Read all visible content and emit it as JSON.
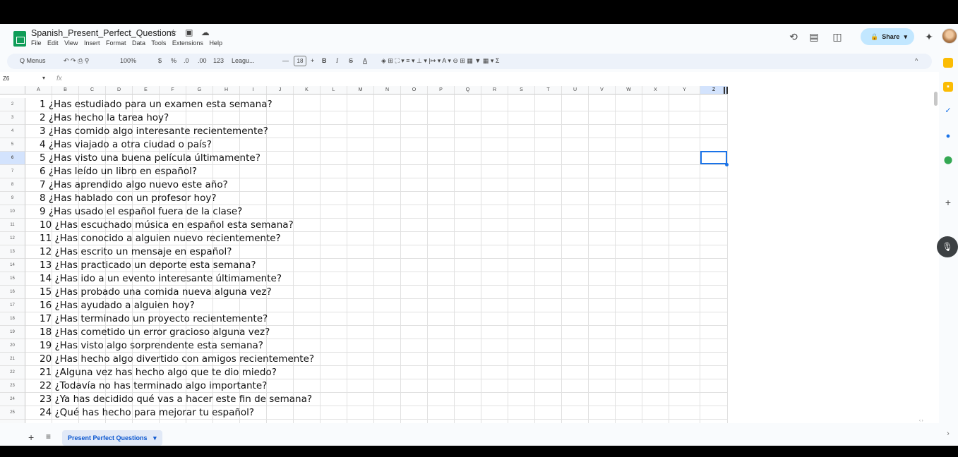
{
  "doc": {
    "title": "Spanish_Present_Perfect_Questions",
    "title_icons": "☆ ▣ ☁"
  },
  "menu": [
    "File",
    "Edit",
    "View",
    "Insert",
    "Format",
    "Data",
    "Tools",
    "Extensions",
    "Help"
  ],
  "header_right": {
    "share_label": "Share"
  },
  "toolbar": {
    "menus_label": "Q Menus",
    "undo_redo": "↶ ↷ ⎙ ⚲",
    "zoom": "100%",
    "currency": "$",
    "percent": "%",
    "dec_minus": ".0",
    "dec_plus": ".00",
    "num_format": "123",
    "font": "Leagu...",
    "minus": "—",
    "font_size": "18",
    "plus": "+",
    "bold": "B",
    "italic": "I",
    "strike": "S",
    "text_color": "A",
    "more_tools": "◈  ⊞  ⛶ ▾  ≡ ▾  ⊥ ▾  |↦ ▾  A ▾  ⊖  ⊞  ▦  ▼  ▦ ▾  Σ",
    "collapse": "^"
  },
  "formula_bar": {
    "name_box": "Z6",
    "fx": "fx"
  },
  "grid": {
    "columns": [
      "A",
      "B",
      "C",
      "D",
      "E",
      "F",
      "G",
      "H",
      "I",
      "J",
      "K",
      "L",
      "M",
      "N",
      "O",
      "P",
      "Q",
      "R",
      "S",
      "T",
      "U",
      "V",
      "W",
      "X",
      "Y",
      "Z"
    ],
    "selected_column": "Z",
    "selected_row": "6",
    "rows": [
      {
        "num": "2",
        "text": "1 ¿Has estudiado para un examen esta semana?"
      },
      {
        "num": "3",
        "text": "2 ¿Has hecho la tarea hoy?"
      },
      {
        "num": "4",
        "text": "3 ¿Has comido algo interesante recientemente?"
      },
      {
        "num": "5",
        "text": "4 ¿Has viajado a otra ciudad o país?"
      },
      {
        "num": "6",
        "text": "5 ¿Has visto una buena película últimamente?"
      },
      {
        "num": "7",
        "text": "6 ¿Has leído un libro en español?"
      },
      {
        "num": "8",
        "text": "7 ¿Has aprendido algo nuevo este año?"
      },
      {
        "num": "9",
        "text": "8 ¿Has hablado con un profesor hoy?"
      },
      {
        "num": "10",
        "text": "9 ¿Has usado el español fuera de la clase?"
      },
      {
        "num": "11",
        "text": "10 ¿Has escuchado música en español esta semana?"
      },
      {
        "num": "12",
        "text": "11 ¿Has conocido a alguien nuevo recientemente?"
      },
      {
        "num": "13",
        "text": "12 ¿Has escrito un mensaje en español?"
      },
      {
        "num": "14",
        "text": "13 ¿Has practicado un deporte esta semana?"
      },
      {
        "num": "15",
        "text": "14 ¿Has ido a un evento interesante últimamente?"
      },
      {
        "num": "16",
        "text": "15 ¿Has probado una comida nueva alguna vez?"
      },
      {
        "num": "17",
        "text": "16 ¿Has ayudado a alguien hoy?"
      },
      {
        "num": "18",
        "text": "17 ¿Has terminado un proyecto recientemente?"
      },
      {
        "num": "19",
        "text": "18 ¿Has cometido un error gracioso alguna vez?"
      },
      {
        "num": "20",
        "text": "19 ¿Has visto algo sorprendente esta semana?"
      },
      {
        "num": "21",
        "text": "20 ¿Has hecho algo divertido con amigos recientemente?"
      },
      {
        "num": "22",
        "text": "21 ¿Alguna vez has hecho algo que te dio miedo?"
      },
      {
        "num": "23",
        "text": "22 ¿Todavía no has terminado algo importante?"
      },
      {
        "num": "24",
        "text": "23 ¿Ya has decidido qué vas a hacer este fin de semana?"
      },
      {
        "num": "25",
        "text": "24 ¿Qué has hecho para mejorar tu español?"
      }
    ]
  },
  "sheets": {
    "add": "+",
    "all": "≡",
    "active_tab": "Present Perfect Questions"
  },
  "colors": {
    "accent": "#1a73e8",
    "share_bg": "#c2e7ff",
    "toolbar_bg": "#edf2fa",
    "sheets_green": "#0f9d58"
  }
}
